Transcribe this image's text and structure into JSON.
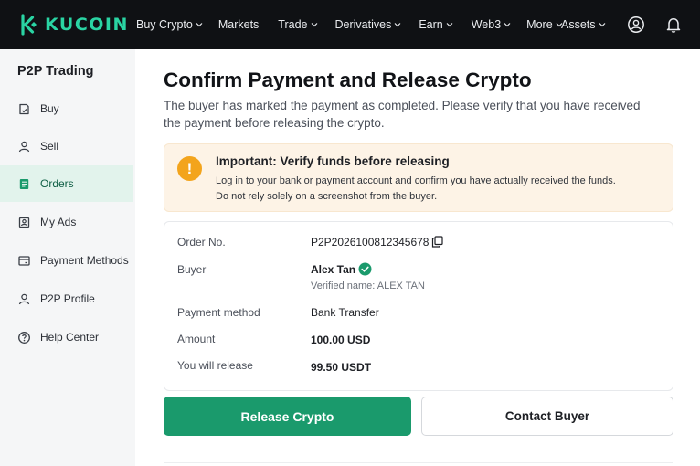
{
  "brand": {
    "name": "KUCOIN",
    "color": "#2ad4a3"
  },
  "nav": {
    "items": [
      {
        "label": "Buy Crypto",
        "dropdown": true
      },
      {
        "label": "Markets",
        "dropdown": false
      },
      {
        "label": "Trade",
        "dropdown": true
      },
      {
        "label": "Derivatives",
        "dropdown": true
      },
      {
        "label": "Earn",
        "dropdown": true
      },
      {
        "label": "Web3",
        "dropdown": true
      },
      {
        "label": "More",
        "dropdown": true
      }
    ],
    "assets_label": "Assets",
    "icons": [
      "user-icon",
      "bell-icon"
    ]
  },
  "sidebar": {
    "title": "P2P Trading",
    "items": [
      {
        "label": "Buy",
        "icon": "buy-icon",
        "active": false
      },
      {
        "label": "Sell",
        "icon": "sell-icon",
        "active": false
      },
      {
        "label": "Orders",
        "icon": "orders-icon",
        "active": true
      },
      {
        "label": "My Ads",
        "icon": "my-ads-icon",
        "active": false
      },
      {
        "label": "Payment Methods",
        "icon": "payment-methods-icon",
        "active": false
      },
      {
        "label": "P2P Profile",
        "icon": "profile-icon",
        "active": false
      },
      {
        "label": "Help Center",
        "icon": "help-icon",
        "active": false
      }
    ]
  },
  "main": {
    "title": "Confirm Payment and Release Crypto",
    "description": "The buyer has marked the payment as completed. Please verify that you have received the payment before releasing the crypto.",
    "alert": {
      "icon": "!",
      "title": "Important: Verify funds before releasing",
      "line1": "Log in to your bank or payment account and confirm you have actually received the funds.",
      "line2": "Do not rely solely on a screenshot from the buyer.",
      "color": "#f3a41c"
    },
    "details": {
      "order_no_label": "Order No.",
      "order_no": "P2P2026100812345678",
      "buyer_label": "Buyer",
      "buyer_name": "Alex Tan",
      "buyer_verified": "Verified name: ALEX TAN",
      "payment_method_label": "Payment method",
      "payment_method": "Bank Transfer",
      "amount_label": "Amount",
      "amount": "100.00 USD",
      "release_label": "You will release",
      "release_amount": "99.50 USDT"
    },
    "actions": {
      "release_label": "Release Crypto",
      "contact_label": "Contact Buyer",
      "primary_color": "#1a9a6c"
    }
  }
}
